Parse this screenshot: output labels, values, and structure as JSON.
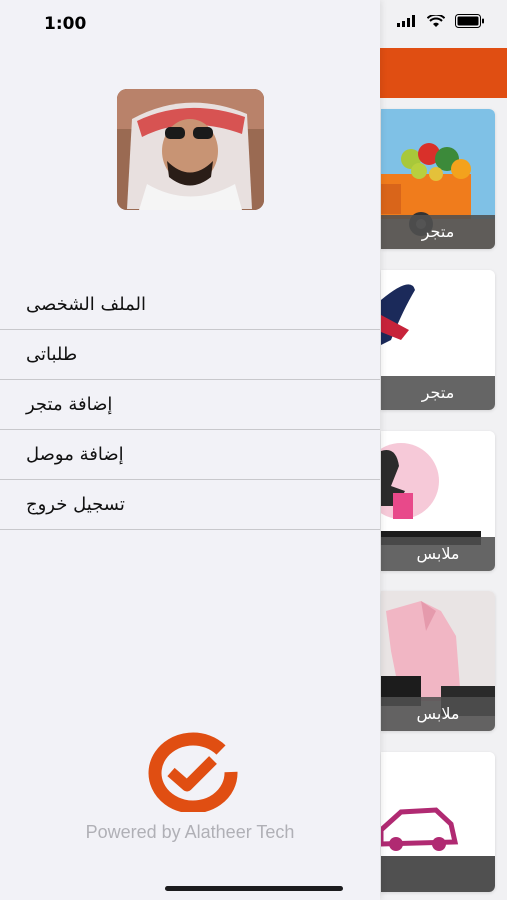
{
  "status_bar": {
    "time": "1:00"
  },
  "drawer": {
    "menu": [
      {
        "label": "الملف الشخصى"
      },
      {
        "label": "طلباتى"
      },
      {
        "label": "إضافة متجر"
      },
      {
        "label": "إضافة موصل"
      },
      {
        "label": "تسجيل خروج"
      }
    ],
    "footer": "Powered by Alatheer Tech"
  },
  "background_cards": [
    {
      "label": "متجر"
    },
    {
      "label": "متجر"
    },
    {
      "label": "ملابس"
    },
    {
      "label": "ملابس"
    },
    {
      "label": ""
    }
  ],
  "colors": {
    "brand": "#e04e12",
    "drawer_bg": "#f2f2f7"
  }
}
